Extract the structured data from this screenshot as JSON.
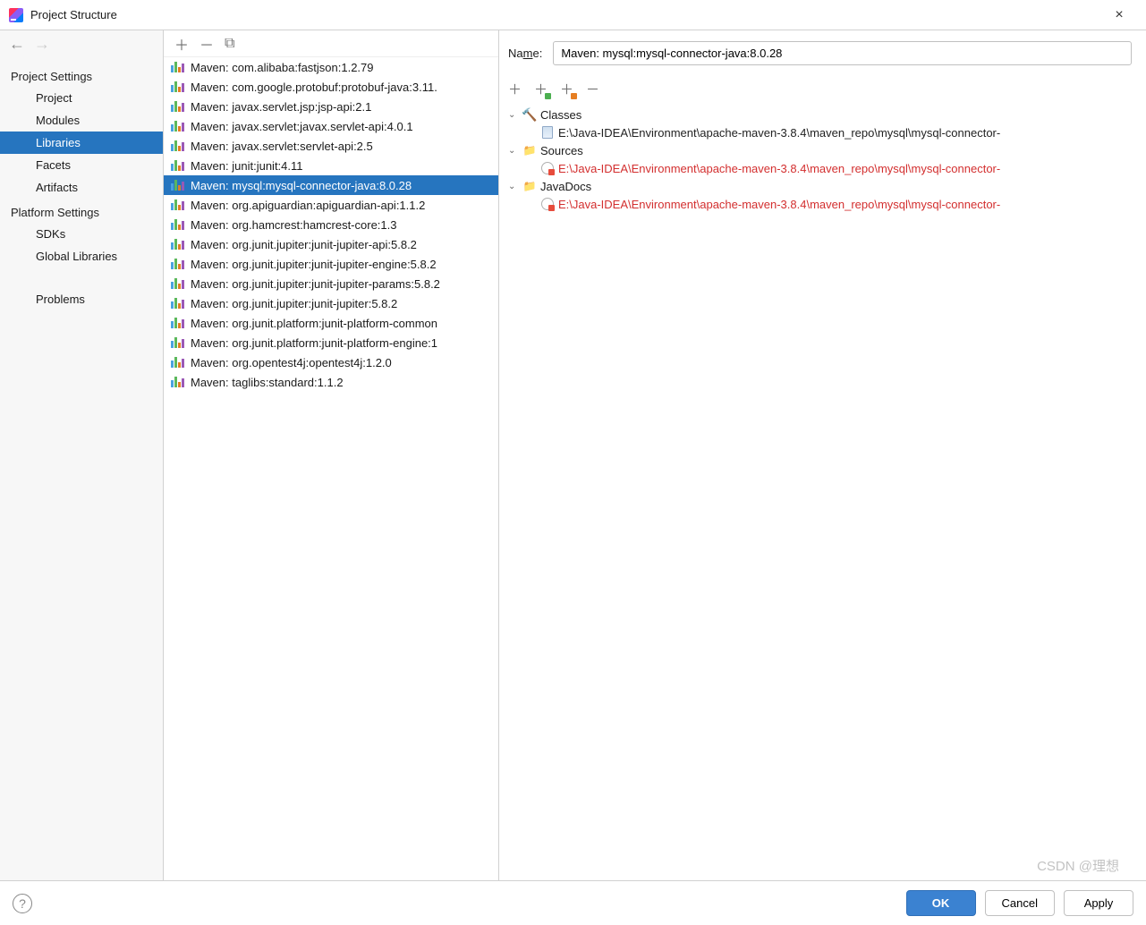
{
  "window": {
    "title": "Project Structure"
  },
  "sidebar": {
    "group1_title": "Project Settings",
    "group1": [
      "Project",
      "Modules",
      "Libraries",
      "Facets",
      "Artifacts"
    ],
    "group1_selected": 2,
    "group2_title": "Platform Settings",
    "group2": [
      "SDKs",
      "Global Libraries"
    ],
    "problems": "Problems"
  },
  "libraries": {
    "items": [
      "Maven: com.alibaba:fastjson:1.2.79",
      "Maven: com.google.protobuf:protobuf-java:3.11.",
      "Maven: javax.servlet.jsp:jsp-api:2.1",
      "Maven: javax.servlet:javax.servlet-api:4.0.1",
      "Maven: javax.servlet:servlet-api:2.5",
      "Maven: junit:junit:4.11",
      "Maven: mysql:mysql-connector-java:8.0.28",
      "Maven: org.apiguardian:apiguardian-api:1.1.2",
      "Maven: org.hamcrest:hamcrest-core:1.3",
      "Maven: org.junit.jupiter:junit-jupiter-api:5.8.2",
      "Maven: org.junit.jupiter:junit-jupiter-engine:5.8.2",
      "Maven: org.junit.jupiter:junit-jupiter-params:5.8.2",
      "Maven: org.junit.jupiter:junit-jupiter:5.8.2",
      "Maven: org.junit.platform:junit-platform-common",
      "Maven: org.junit.platform:junit-platform-engine:1",
      "Maven: org.opentest4j:opentest4j:1.2.0",
      "Maven: taglibs:standard:1.1.2"
    ],
    "selected": 6
  },
  "details": {
    "name_label": "Name:",
    "name_value": "Maven: mysql:mysql-connector-java:8.0.28",
    "sections": [
      {
        "kind": "classes",
        "label": "Classes",
        "path": "E:\\Java-IDEA\\Environment\\apache-maven-3.8.4\\maven_repo\\mysql\\mysql-connector-",
        "error": false
      },
      {
        "kind": "sources",
        "label": "Sources",
        "path": "E:\\Java-IDEA\\Environment\\apache-maven-3.8.4\\maven_repo\\mysql\\mysql-connector-",
        "error": true
      },
      {
        "kind": "javadocs",
        "label": "JavaDocs",
        "path": "E:\\Java-IDEA\\Environment\\apache-maven-3.8.4\\maven_repo\\mysql\\mysql-connector-",
        "error": true
      }
    ]
  },
  "footer": {
    "ok": "OK",
    "cancel": "Cancel",
    "apply": "Apply"
  },
  "watermark": "CSDN @理想"
}
